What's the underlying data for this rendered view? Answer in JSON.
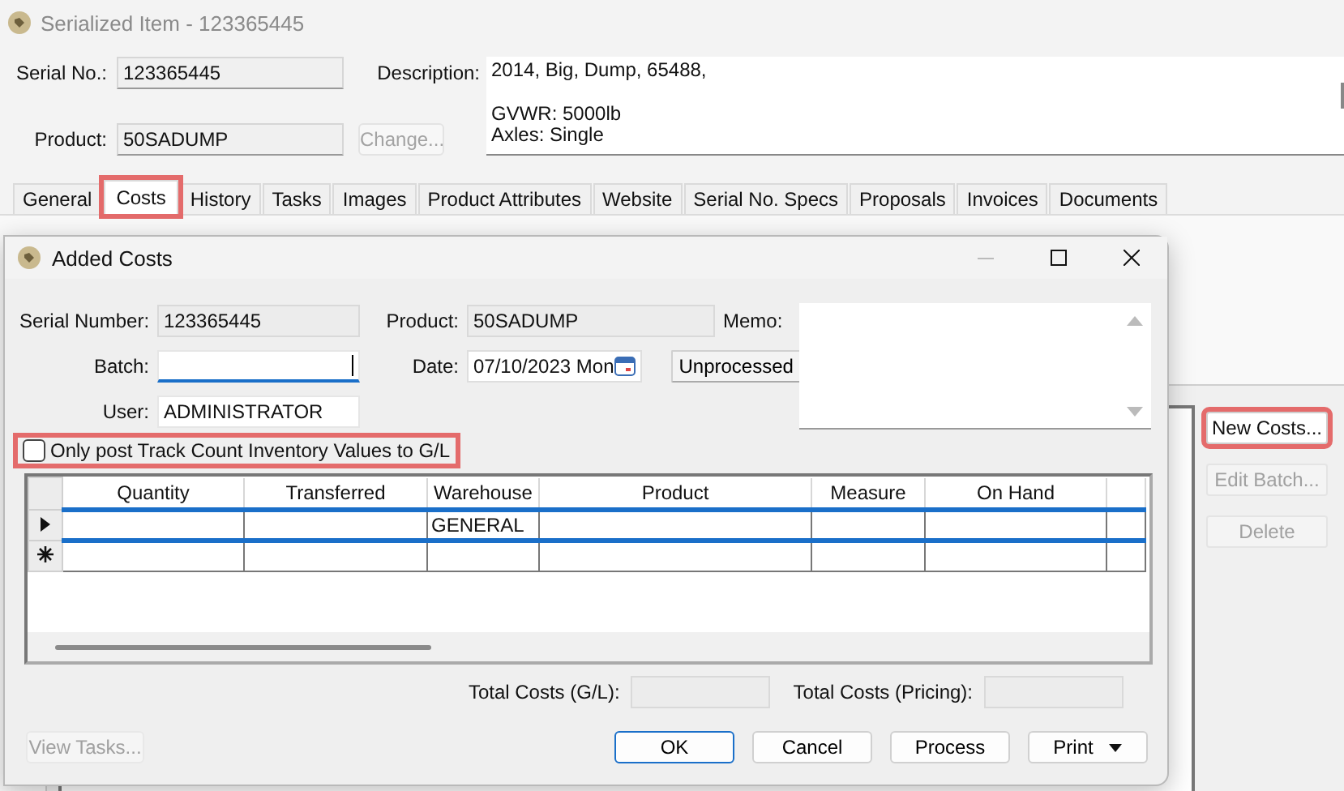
{
  "main_window": {
    "title": "Serialized Item - 123365445",
    "serial_no": {
      "label": "Serial No.:",
      "value": "123365445"
    },
    "product": {
      "label": "Product:",
      "value": "50SADUMP"
    },
    "change_button": {
      "label": "Change...",
      "disabled": true
    },
    "description": {
      "label": "Description:",
      "paragraphs": [
        [
          "2014, Big, Dump, 65488,"
        ],
        [
          "GVWR: 5000lb",
          "Axles: Single"
        ]
      ]
    },
    "tabs": [
      {
        "label": "General",
        "selected": false,
        "highlighted": false
      },
      {
        "label": "Costs",
        "selected": true,
        "highlighted": true
      },
      {
        "label": "History",
        "selected": false,
        "highlighted": false
      },
      {
        "label": "Tasks",
        "selected": false,
        "highlighted": false
      },
      {
        "label": "Images",
        "selected": false,
        "highlighted": false
      },
      {
        "label": "Product Attributes",
        "selected": false,
        "highlighted": false
      },
      {
        "label": "Website",
        "selected": false,
        "highlighted": false
      },
      {
        "label": "Serial No. Specs",
        "selected": false,
        "highlighted": false
      },
      {
        "label": "Proposals",
        "selected": false,
        "highlighted": false
      },
      {
        "label": "Invoices",
        "selected": false,
        "highlighted": false
      },
      {
        "label": "Documents",
        "selected": false,
        "highlighted": false
      }
    ],
    "side_buttons": [
      {
        "label": "New Costs...",
        "disabled": false,
        "highlighted": true
      },
      {
        "label": "Edit Batch...",
        "disabled": true,
        "highlighted": false
      },
      {
        "label": "Delete",
        "disabled": true,
        "highlighted": false
      }
    ]
  },
  "dialog": {
    "title": "Added Costs",
    "serial_number": {
      "label": "Serial Number:",
      "value": "123365445"
    },
    "product": {
      "label": "Product:",
      "value": "50SADUMP"
    },
    "memo": {
      "label": "Memo:"
    },
    "batch": {
      "label": "Batch:",
      "focused": true
    },
    "date": {
      "label": "Date:",
      "value": "07/10/2023 Mon"
    },
    "status_button": {
      "label": "Unprocessed"
    },
    "user": {
      "label": "User:",
      "value": "ADMINISTRATOR"
    },
    "post_checkbox": {
      "label": "Only post Track Count Inventory Values to G/L",
      "checked": false,
      "highlighted": true
    },
    "grid": {
      "columns": [
        "Quantity",
        "Transferred",
        "Warehouse",
        "Product",
        "Measure",
        "On Hand"
      ],
      "rows": [
        {
          "kind": "current",
          "selected": true,
          "cells": [
            null,
            null,
            "GENERAL",
            null,
            null,
            null
          ]
        },
        {
          "kind": "new",
          "selected": false,
          "cells": [
            null,
            null,
            null,
            null,
            null,
            null
          ]
        }
      ]
    },
    "totals": [
      {
        "label": "Total Costs (G/L):"
      },
      {
        "label": "Total Costs (Pricing):"
      }
    ],
    "view_tasks_button": {
      "label": "View Tasks...",
      "disabled": true
    },
    "buttons": [
      {
        "label": "OK",
        "kind": "default"
      },
      {
        "label": "Cancel",
        "kind": "normal"
      },
      {
        "label": "Process",
        "kind": "normal"
      },
      {
        "label": "Print",
        "kind": "dropdown"
      }
    ]
  }
}
